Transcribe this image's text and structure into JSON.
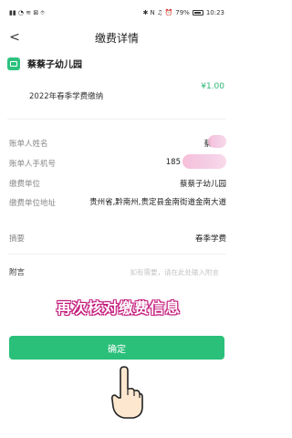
{
  "status_bar": {
    "left_icons": "▮▮ ◔ ≋ ⊠ ⌾",
    "right_icons": "✱ N ♫ ⏰",
    "battery": "79%",
    "time": "10:23"
  },
  "nav": {
    "back_glyph": "<",
    "title": "缴费详情"
  },
  "merchant": {
    "name": "蔡蔡子幼儿园"
  },
  "payment": {
    "amount": "¥1.00",
    "item": "2022年春季学费缴纳"
  },
  "fields": [
    {
      "label": "账单人姓名",
      "value": "蔡"
    },
    {
      "label": "账单人手机号",
      "value": "185"
    },
    {
      "label": "缴费单位",
      "value": "蔡蔡子幼儿园"
    },
    {
      "label": "缴费单位地址",
      "value": "贵州省,黔南州,贵定县金南街道金南大道"
    },
    {
      "label": "摘要",
      "value": "春季学费"
    }
  ],
  "memo": {
    "label": "附言",
    "placeholder": "如有需要，请在此处输入附言"
  },
  "overlay_caption": "再次核对缴费信息",
  "confirm_button": "确定",
  "colors": {
    "accent": "#2bc07a",
    "amount": "#2bb673",
    "caption_outline": "#c2187a"
  }
}
